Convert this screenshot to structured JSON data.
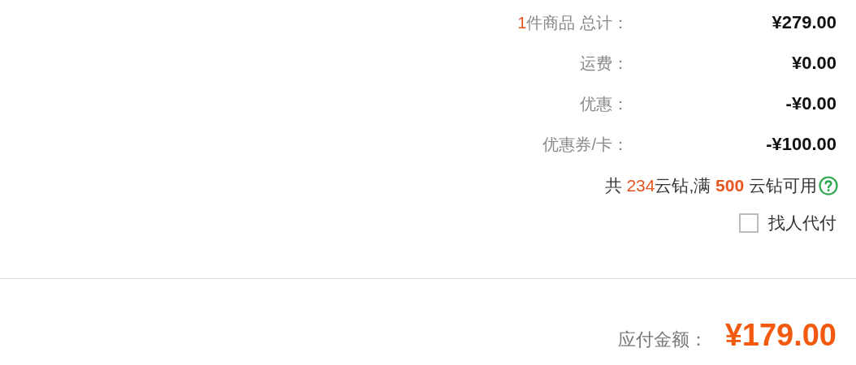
{
  "summary": {
    "item_count": "1",
    "item_label": "件商品 总计：",
    "rows": [
      {
        "label": "运费：",
        "value": "¥0.00"
      },
      {
        "label": "优惠：",
        "value": "-¥0.00"
      },
      {
        "label": "优惠券/卡：",
        "value": "-¥100.00"
      }
    ],
    "total_value": "¥279.00"
  },
  "points": {
    "prefix": "共",
    "balance": "234",
    "middle": "云钻,满",
    "threshold": "500",
    "suffix": "云钻可用"
  },
  "pay_for_me": {
    "label": "找人代付",
    "checked": false
  },
  "amount_due": {
    "label": "应付金额：",
    "value": "¥179.00"
  }
}
